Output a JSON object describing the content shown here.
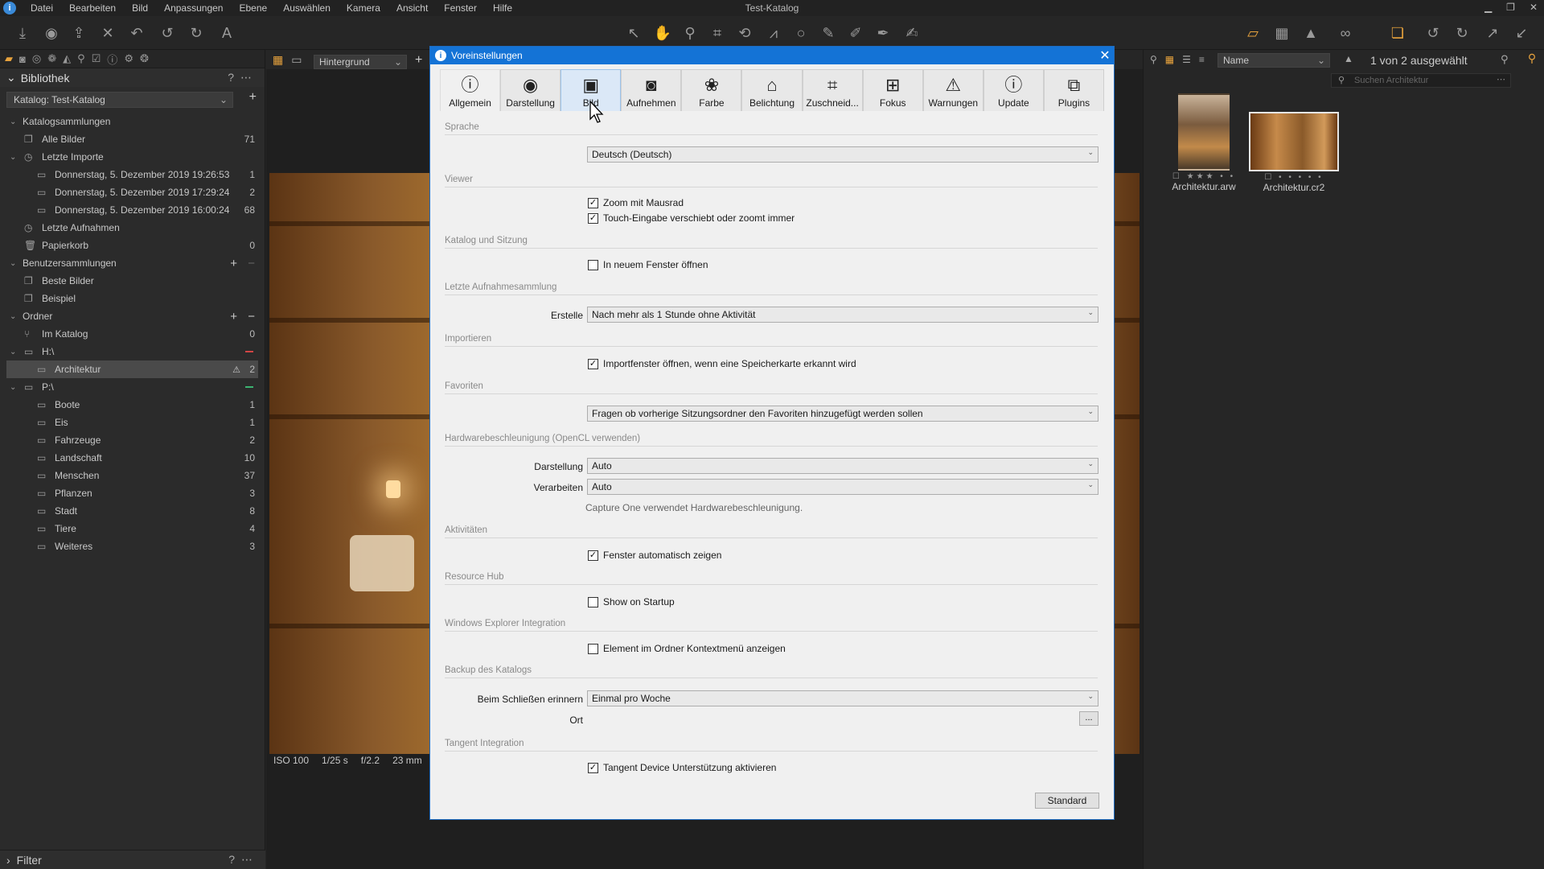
{
  "app": {
    "window_title": "Test-Katalog",
    "menu": [
      "Datei",
      "Bearbeiten",
      "Bild",
      "Anpassungen",
      "Ebene",
      "Auswählen",
      "Kamera",
      "Ansicht",
      "Fenster",
      "Hilfe"
    ]
  },
  "left_panel": {
    "header": "Bibliothek",
    "catalog": "Katalog: Test-Katalog",
    "tree": [
      {
        "label": "Katalogsammlungen",
        "type": "group",
        "expanded": true
      },
      {
        "label": "Alle Bilder",
        "count": "71",
        "icon": "stack-icon"
      },
      {
        "label": "Letzte Importe",
        "type": "subgroup",
        "expanded": true
      },
      {
        "label": "Donnerstag, 5. Dezember 2019 19:26:53",
        "count": "1"
      },
      {
        "label": "Donnerstag, 5. Dezember 2019 17:29:24",
        "count": "2"
      },
      {
        "label": "Donnerstag, 5. Dezember 2019 16:00:24",
        "count": "68"
      },
      {
        "label": "Letzte Aufnahmen",
        "count": ""
      },
      {
        "label": "Papierkorb",
        "count": "0"
      },
      {
        "label": "Benutzersammlungen",
        "type": "group",
        "expanded": true
      },
      {
        "label": "Beste Bilder",
        "count": ""
      },
      {
        "label": "Beispiel",
        "count": ""
      },
      {
        "label": "Ordner",
        "type": "group",
        "expanded": true
      },
      {
        "label": "Im Katalog",
        "count": "0"
      },
      {
        "label": "H:\\",
        "type": "drive"
      },
      {
        "label": "Architektur",
        "count": "2",
        "selected": true
      },
      {
        "label": "P:\\",
        "type": "drive"
      },
      {
        "label": "Boote",
        "count": "1"
      },
      {
        "label": "Eis",
        "count": "1"
      },
      {
        "label": "Fahrzeuge",
        "count": "2"
      },
      {
        "label": "Landschaft",
        "count": "10"
      },
      {
        "label": "Menschen",
        "count": "37"
      },
      {
        "label": "Pflanzen",
        "count": "3"
      },
      {
        "label": "Stadt",
        "count": "8"
      },
      {
        "label": "Tiere",
        "count": "4"
      },
      {
        "label": "Weiteres",
        "count": "3"
      }
    ],
    "footer": "Filter"
  },
  "viewer": {
    "background_select": "Hintergrund",
    "exif": {
      "iso": "ISO 100",
      "shutter": "1/25 s",
      "aperture": "f/2.2",
      "focal": "23 mm"
    }
  },
  "browser": {
    "sort": "Name",
    "selection_info": "1 von 2 ausgewählt",
    "search_placeholder": "Suchen Architektur",
    "thumbs": [
      {
        "name": "Architektur.arw",
        "rating": 3,
        "selected": false
      },
      {
        "name": "Architektur.cr2",
        "rating": 0,
        "selected": true
      }
    ]
  },
  "dialog": {
    "title": "Voreinstellungen",
    "tabs": [
      {
        "label": "Allgemein",
        "icon": "info-icon"
      },
      {
        "label": "Darstellung",
        "icon": "eye-icon"
      },
      {
        "label": "Bild",
        "icon": "image-icon"
      },
      {
        "label": "Aufnehmen",
        "icon": "camera-icon"
      },
      {
        "label": "Farbe",
        "icon": "color-circles-icon"
      },
      {
        "label": "Belichtung",
        "icon": "exposure-icon"
      },
      {
        "label": "Zuschneid...",
        "icon": "crop-icon"
      },
      {
        "label": "Fokus",
        "icon": "focus-icon"
      },
      {
        "label": "Warnungen",
        "icon": "warning-icon"
      },
      {
        "label": "Update",
        "icon": "update-icon"
      },
      {
        "label": "Plugins",
        "icon": "plugin-icon"
      }
    ],
    "sections": {
      "sprache": {
        "title": "Sprache",
        "value": "Deutsch (Deutsch)"
      },
      "viewer": {
        "title": "Viewer",
        "zoom": "Zoom mit Mausrad",
        "touch": "Touch-Eingabe verschiebt oder zoomt immer"
      },
      "katalog": {
        "title": "Katalog und Sitzung",
        "new_window": "In neuem Fenster öffnen"
      },
      "letzte": {
        "title": "Letzte Aufnahmesammlung",
        "label": "Erstelle",
        "value": "Nach mehr als 1 Stunde ohne Aktivität"
      },
      "import": {
        "title": "Importieren",
        "option": "Importfenster öffnen, wenn eine Speicherkarte erkannt wird"
      },
      "favoriten": {
        "title": "Favoriten",
        "value": "Fragen ob vorherige Sitzungsordner den Favoriten hinzugefügt werden sollen"
      },
      "hardware": {
        "title": "Hardwarebeschleunigung (OpenCL verwenden)",
        "darstellung_label": "Darstellung",
        "darstellung_value": "Auto",
        "verarbeiten_label": "Verarbeiten",
        "verarbeiten_value": "Auto",
        "note": "Capture One verwendet Hardwarebeschleunigung."
      },
      "aktivitaeten": {
        "title": "Aktivitäten",
        "option": "Fenster automatisch zeigen"
      },
      "resource": {
        "title": "Resource Hub",
        "option": "Show on Startup"
      },
      "explorer": {
        "title": "Windows Explorer Integration",
        "option": "Element im Ordner Kontextmenü anzeigen"
      },
      "backup": {
        "title": "Backup des Katalogs",
        "label": "Beim Schließen erinnern",
        "value": "Einmal pro Woche",
        "ort_label": "Ort",
        "ort_button": "..."
      },
      "tangent": {
        "title": "Tangent Integration",
        "option": "Tangent Device Unterstützung aktivieren"
      }
    },
    "standard_button": "Standard"
  }
}
